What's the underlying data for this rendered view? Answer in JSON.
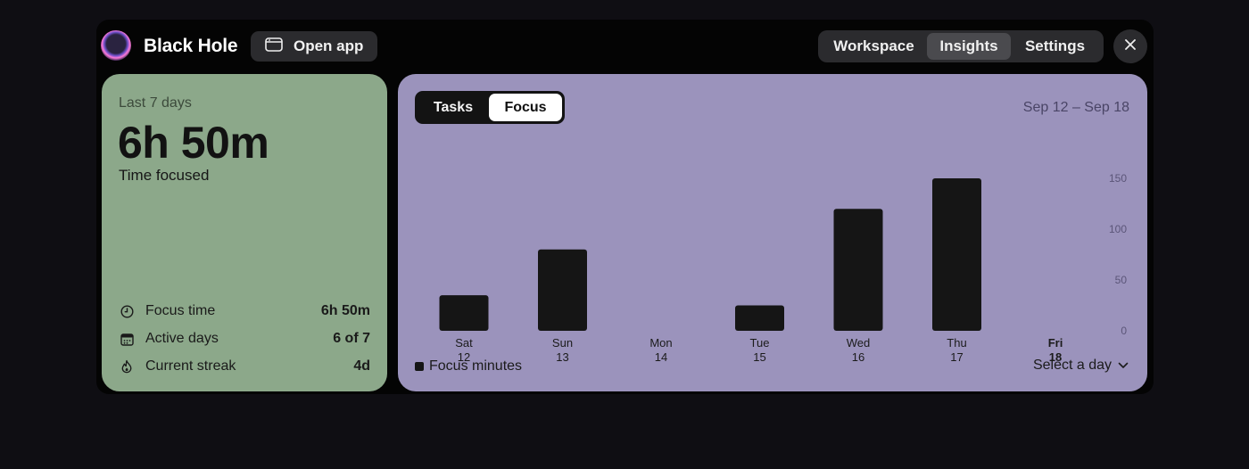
{
  "header": {
    "app_title": "Black Hole",
    "open_app_label": "Open app",
    "tabs": [
      {
        "label": "Workspace",
        "active": false
      },
      {
        "label": "Insights",
        "active": true
      },
      {
        "label": "Settings",
        "active": false
      }
    ]
  },
  "summary": {
    "period": "Last 7 days",
    "total": "6h 50m",
    "total_label": "Time focused",
    "stats": [
      {
        "icon": "clock-icon",
        "label": "Focus time",
        "value": "6h 50m"
      },
      {
        "icon": "calendar-icon",
        "label": "Active days",
        "value": "6 of 7"
      },
      {
        "icon": "flame-icon",
        "label": "Current streak",
        "value": "4d"
      }
    ]
  },
  "insights": {
    "toggle": [
      {
        "label": "Tasks",
        "active": false
      },
      {
        "label": "Focus",
        "active": true
      }
    ],
    "date_range": "Sep 12 – Sep 18",
    "legend_label": "Focus minutes",
    "select_day_label": "Select a day"
  },
  "colors": {
    "green_card": "#8ca88a",
    "purple_card": "#9b93bc",
    "bar": "#151515"
  },
  "chart_data": {
    "type": "bar",
    "categories": [
      {
        "day": "Sat",
        "date": "12"
      },
      {
        "day": "Sun",
        "date": "13"
      },
      {
        "day": "Mon",
        "date": "14"
      },
      {
        "day": "Tue",
        "date": "15"
      },
      {
        "day": "Wed",
        "date": "16"
      },
      {
        "day": "Thu",
        "date": "17"
      },
      {
        "day": "Fri",
        "date": "18"
      }
    ],
    "values": [
      35,
      80,
      0,
      25,
      120,
      150,
      0
    ],
    "highlighted_category": "Fri",
    "yticks": [
      0,
      50,
      100,
      150
    ],
    "ylim": [
      0,
      150
    ],
    "y_axis_position": "right",
    "grid": false,
    "legend": "bottom-left"
  }
}
